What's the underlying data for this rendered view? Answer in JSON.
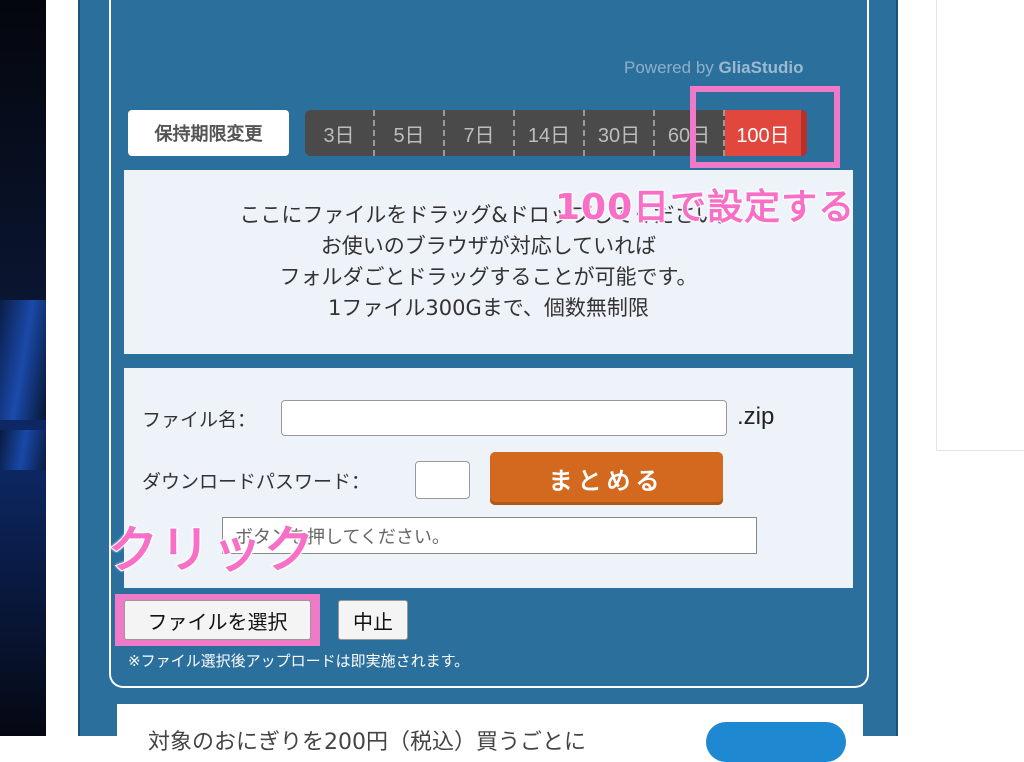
{
  "powered_by": {
    "prefix": "Powered by ",
    "brand": "GliaStudio"
  },
  "retention": {
    "label": "保持期限変更",
    "options": [
      "3日",
      "5日",
      "7日",
      "14日",
      "30日",
      "60日",
      "100日"
    ],
    "active": "100日"
  },
  "annotations": {
    "set_100": "100日で設定する",
    "click": "クリック"
  },
  "drop_zone": {
    "lines": [
      "ここにファイルをドラッグ&ドロップしてください。",
      "お使いのブラウザが対応していれば",
      "フォルダごとドラッグすることが可能です。",
      "1ファイル300Gまで、個数無制限"
    ]
  },
  "form": {
    "filename_label": "ファイル名：",
    "filename_value": "",
    "extension": ".zip",
    "password_label": "ダウンロードパスワード：",
    "password_value": "",
    "submit_label": "まとめる",
    "message_text": "ボタンを押してください。"
  },
  "actions": {
    "select_label": "ファイルを選択",
    "cancel_label": "中止",
    "note": "※ファイル選択後アップロードは即実施されます。"
  },
  "footer": {
    "text": "対象のおにぎりを200円（税込）買うごとに"
  },
  "colors": {
    "panel": "#2b6f9d",
    "active_period": "#e2473d",
    "submit_button": "#d2691e",
    "annotation": "#f76fc6"
  }
}
